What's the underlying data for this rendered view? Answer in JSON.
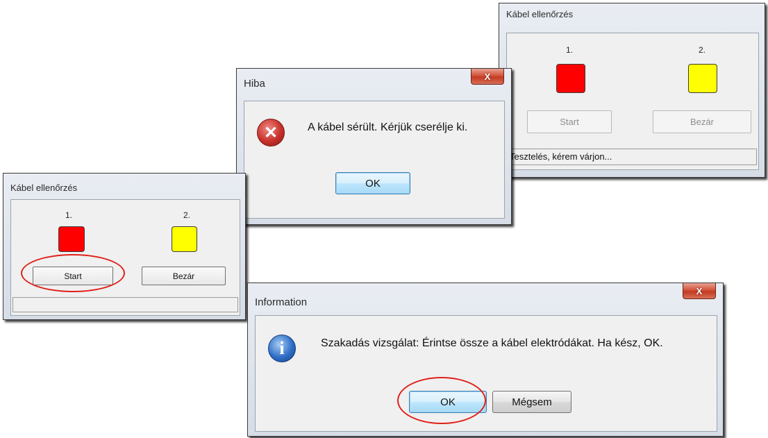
{
  "colors": {
    "indicator_1": "#ff0000",
    "indicator_2": "#ffff00",
    "callout": "#e0201a"
  },
  "left_dialog": {
    "title": "Kábel ellenőrzés",
    "label_1": "1.",
    "label_2": "2.",
    "start_label": "Start",
    "close_label": "Bezár",
    "status_text": ""
  },
  "right_dialog": {
    "title": "Kábel ellenőrzés",
    "label_1": "1.",
    "label_2": "2.",
    "start_label": "Start",
    "close_label": "Bezár",
    "status_text": "Tesztelés, kérem várjon..."
  },
  "error_dialog": {
    "title": "Hiba",
    "close_glyph": "X",
    "icon": "error-icon",
    "message": "A kábel sérült. Kérjük cserélje ki.",
    "ok_label": "OK"
  },
  "info_dialog": {
    "title": "Information",
    "close_glyph": "X",
    "icon": "info-icon",
    "message": "Szakadás vizsgálat: Érintse össze a kábel elektródákat. Ha kész, OK.",
    "ok_label": "OK",
    "cancel_label": "Mégsem"
  }
}
